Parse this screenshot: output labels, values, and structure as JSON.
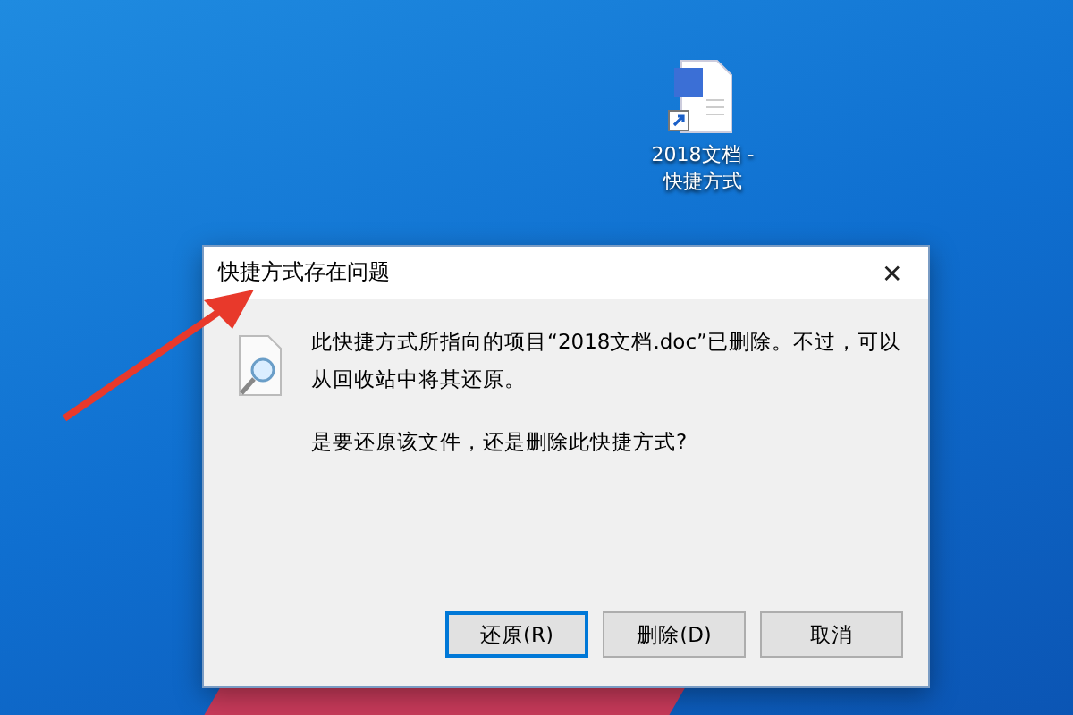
{
  "desktop_icon": {
    "label": "2018文档 - 快捷方式"
  },
  "dialog": {
    "title": "快捷方式存在问题",
    "close": "✕",
    "message": "此快捷方式所指向的项目“2018文档.doc”已删除。不过，可以从回收站中将其还原。",
    "question": "是要还原该文件，还是删除此快捷方式?",
    "buttons": [
      {
        "label": "还原(R)",
        "focused": true
      },
      {
        "label": "删除(D)",
        "focused": false
      },
      {
        "label": "取消",
        "focused": false
      }
    ]
  }
}
